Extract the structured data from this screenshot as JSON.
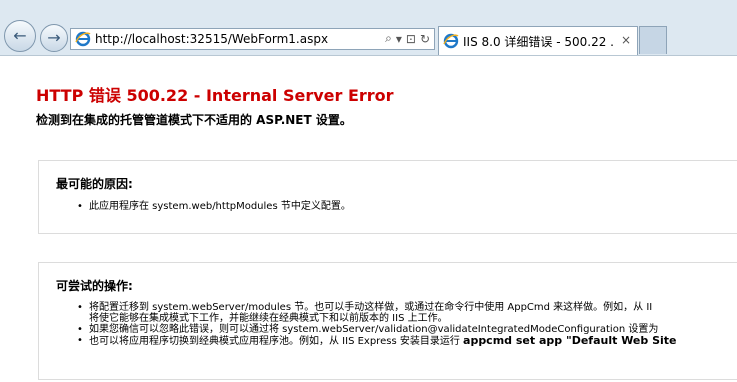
{
  "browser": {
    "back_glyph": "←",
    "forward_glyph": "→",
    "url": "http://localhost:32515/WebForm1.aspx",
    "tab_title": "IIS 8.0 详细错误 - 500.22 ...",
    "tab_close": "×",
    "addr_search_glyph": "⌕",
    "addr_dropdown_glyph": "▾",
    "addr_compat_glyph": "⊡",
    "addr_refresh_glyph": "↻"
  },
  "error": {
    "title": "HTTP 错误 500.22 - Internal Server Error",
    "subtitle": "检测到在集成的托管管道模式下不适用的 ASP.NET 设置。"
  },
  "causes": {
    "heading": "最可能的原因:",
    "items": [
      "此应用程序在 system.web/httpModules 节中定义配置。"
    ]
  },
  "actions": {
    "heading": "可尝试的操作:",
    "item1_line1": "将配置迁移到 system.webServer/modules 节。也可以手动这样做，或通过在命令行中使用 AppCmd 来这样做。例如，从 II",
    "item1_line2": "将使它能够在集成模式下工作，并能继续在经典模式下和以前版本的 IIS 上工作。",
    "item2": "如果您确信可以忽略此错误，则可以通过将 system.webServer/validation@validateIntegratedModeConfiguration 设置为",
    "item3_prefix": "也可以将应用程序切换到经典模式应用程序池。例如，从 IIS Express 安装目录运行 ",
    "item3_bold": "appcmd set app \"Default Web Site"
  },
  "colors": {
    "title_red": "#cc0000",
    "chrome_bg": "#dde8f1",
    "panel_border": "#dcdcdc"
  }
}
